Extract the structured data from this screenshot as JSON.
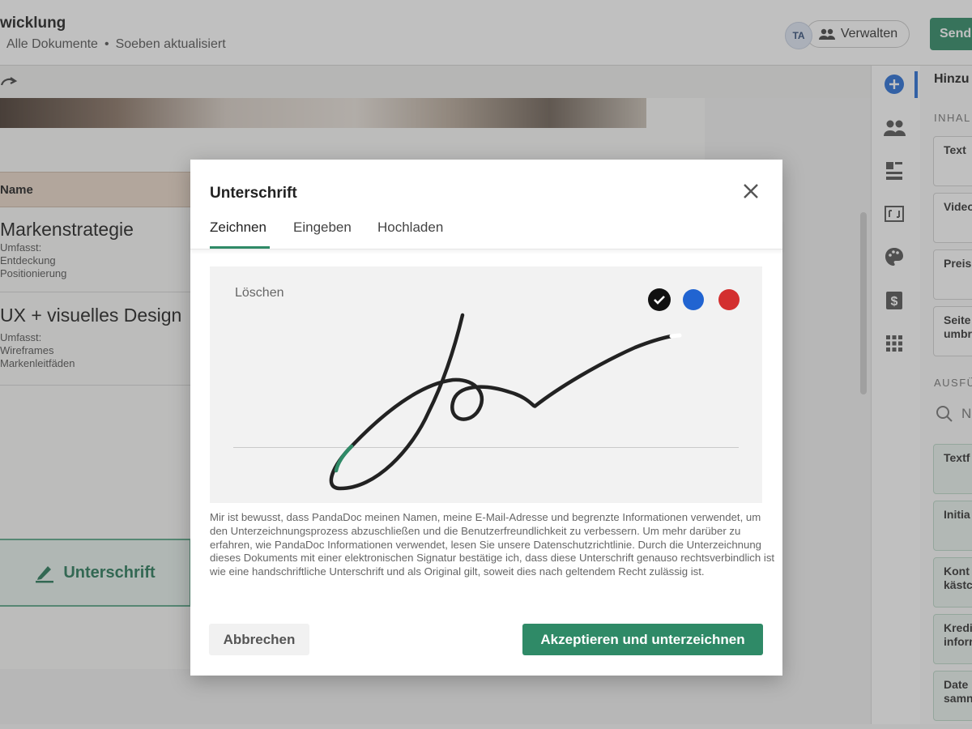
{
  "header": {
    "doc_title": "wicklung",
    "breadcrumb_all": "Alle Dokumente",
    "breadcrumb_status": "Soeben aktualisiert",
    "avatar_initials": "TA",
    "manage_label": "Verwalten",
    "send_label": "Send"
  },
  "document": {
    "table_header": "Name",
    "rows": [
      {
        "title": "Markenstrategie",
        "includes": "Umfasst:",
        "item1": "Entdeckung",
        "item2": "Positionierung"
      },
      {
        "title": "UX + visuelles Design",
        "includes": "Umfasst:",
        "item1": "Wireframes",
        "item2": "Markenleitfäden"
      }
    ],
    "signature_field_label": "Unterschrift"
  },
  "rail": {
    "icons": [
      "add-icon",
      "people-icon",
      "blocks-icon",
      "embed-icon",
      "palette-icon",
      "dollar-icon",
      "grid-icon"
    ]
  },
  "panel": {
    "title": "Hinzu",
    "content_label": "INHAL",
    "content_cards": [
      "Text",
      "Video",
      "Preis",
      "Seite umbr"
    ],
    "fill_label": "AUSFÜ",
    "search_placeholder": "N",
    "fill_cards": [
      "Textf",
      "Initia",
      "Kont kästc",
      "Kredi inforr",
      "Date samn"
    ]
  },
  "modal": {
    "title": "Unterschrift",
    "tabs": [
      "Zeichnen",
      "Eingeben",
      "Hochladen"
    ],
    "active_tab": "Zeichnen",
    "clear_label": "Löschen",
    "colors": {
      "black": "#111111",
      "blue": "#2164d1",
      "red": "#d32f2f"
    },
    "selected_color": "black",
    "legal_text": "Mir ist bewusst, dass PandaDoc meinen Namen, meine E-Mail-Adresse und begrenzte Informationen verwendet, um den Unterzeichnungsprozess abzuschließen und die Benutzerfreundlichkeit zu verbessern. Um mehr darüber zu erfahren, wie PandaDoc Informationen verwendet, lesen Sie unsere Datenschutzrichtlinie. Durch die Unterzeichnung dieses Dokuments mit einer elektronischen Signatur bestätige ich, dass diese Unterschrift genauso rechtsverbindlich ist wie eine handschriftliche Unterschrift und als Original gilt, soweit dies nach geltendem Recht zulässig ist.",
    "cancel_label": "Abbrechen",
    "accept_label": "Akzeptieren und unterzeichnen"
  },
  "accent_color": "#2f8a67"
}
